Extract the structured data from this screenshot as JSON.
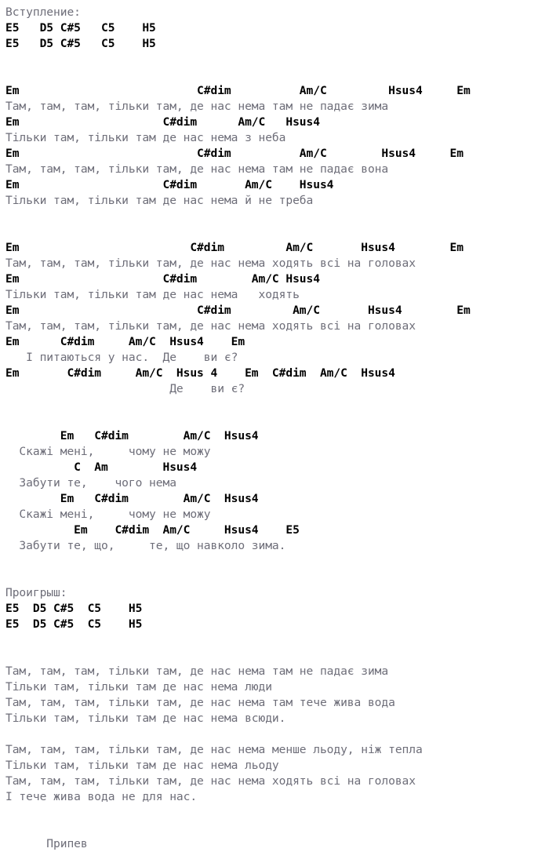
{
  "document": {
    "title": "Chord and lyric sheet",
    "colors": {
      "background": "#ffffff",
      "chord_text": "#000000",
      "lyric_text": "#6e6e79"
    },
    "lines": [
      {
        "kind": "section",
        "text": "Вступление:"
      },
      {
        "kind": "chord",
        "text": "E5   D5 C#5   C5    H5"
      },
      {
        "kind": "chord",
        "text": "E5   D5 C#5   C5    H5"
      },
      {
        "kind": "blank",
        "text": ""
      },
      {
        "kind": "blank",
        "text": ""
      },
      {
        "kind": "chord",
        "text": "Em                          C#dim          Am/C         Hsus4     Em"
      },
      {
        "kind": "lyric",
        "text": "Там, там, там, тільки там, де нас нема там не падає зима"
      },
      {
        "kind": "chord",
        "text": "Em                     C#dim      Am/C   Hsus4"
      },
      {
        "kind": "lyric",
        "text": "Тільки там, тільки там де нас нема з неба"
      },
      {
        "kind": "chord",
        "text": "Em                          C#dim          Am/C        Hsus4     Em"
      },
      {
        "kind": "lyric",
        "text": "Там, там, там, тільки там, де нас нема там не падає вона"
      },
      {
        "kind": "chord",
        "text": "Em                     C#dim       Am/C    Hsus4"
      },
      {
        "kind": "lyric",
        "text": "Тільки там, тільки там де нас нема й не треба"
      },
      {
        "kind": "blank",
        "text": ""
      },
      {
        "kind": "blank",
        "text": ""
      },
      {
        "kind": "chord",
        "text": "Em                         C#dim         Am/C       Hsus4        Em"
      },
      {
        "kind": "lyric",
        "text": "Там, там, там, тільки там, де нас нема ходять всі на головах"
      },
      {
        "kind": "chord",
        "text": "Em                     C#dim        Am/C Hsus4"
      },
      {
        "kind": "lyric",
        "text": "Тільки там, тільки там де нас нема   ходять"
      },
      {
        "kind": "chord",
        "text": "Em                          C#dim         Am/C       Hsus4        Em"
      },
      {
        "kind": "lyric",
        "text": "Там, там, там, тільки там, де нас нема ходять всі на головах"
      },
      {
        "kind": "chord",
        "text": "Em      C#dim     Am/C  Hsus4    Em"
      },
      {
        "kind": "lyric",
        "text": "   І питаються у нас.  Де    ви є?"
      },
      {
        "kind": "chord",
        "text": "Em       C#dim     Am/C  Hsus 4    Em  C#dim  Am/C  Hsus4"
      },
      {
        "kind": "lyric",
        "text": "                        Де    ви є?"
      },
      {
        "kind": "blank",
        "text": ""
      },
      {
        "kind": "blank",
        "text": ""
      },
      {
        "kind": "chord",
        "text": "        Em   C#dim        Am/C  Hsus4"
      },
      {
        "kind": "lyric",
        "text": "  Скажі мені,     чому не можу"
      },
      {
        "kind": "chord",
        "text": "          C  Am        Hsus4"
      },
      {
        "kind": "lyric",
        "text": "  Забути те,    чого нема"
      },
      {
        "kind": "chord",
        "text": "        Em   C#dim        Am/C  Hsus4"
      },
      {
        "kind": "lyric",
        "text": "  Скажі мені,     чому не можу"
      },
      {
        "kind": "chord",
        "text": "          Em    C#dim  Am/C     Hsus4    E5"
      },
      {
        "kind": "lyric",
        "text": "  Забути те, що,     те, що навколо зима."
      },
      {
        "kind": "blank",
        "text": ""
      },
      {
        "kind": "blank",
        "text": ""
      },
      {
        "kind": "section",
        "text": "Проигрыш:"
      },
      {
        "kind": "chord",
        "text": "E5  D5 C#5  C5    H5"
      },
      {
        "kind": "chord",
        "text": "E5  D5 C#5  C5    H5"
      },
      {
        "kind": "blank",
        "text": ""
      },
      {
        "kind": "blank",
        "text": ""
      },
      {
        "kind": "lyric",
        "text": "Там, там, там, тільки там, де нас нема там не падає зима"
      },
      {
        "kind": "lyric",
        "text": "Тільки там, тільки там де нас нема люди"
      },
      {
        "kind": "lyric",
        "text": "Там, там, там, тільки там, де нас нема там тече жива вода"
      },
      {
        "kind": "lyric",
        "text": "Тільки там, тільки там де нас нема всюди."
      },
      {
        "kind": "blank",
        "text": ""
      },
      {
        "kind": "lyric",
        "text": "Там, там, там, тільки там, де нас нема менше льоду, ніж тепла"
      },
      {
        "kind": "lyric",
        "text": "Тільки там, тільки там де нас нема льоду"
      },
      {
        "kind": "lyric",
        "text": "Там, там, там, тільки там, де нас нема ходять всі на головах"
      },
      {
        "kind": "lyric",
        "text": "І тече жива вода не для нас."
      },
      {
        "kind": "blank",
        "text": ""
      },
      {
        "kind": "blank",
        "text": ""
      },
      {
        "kind": "section",
        "text": "      Припев"
      }
    ]
  }
}
